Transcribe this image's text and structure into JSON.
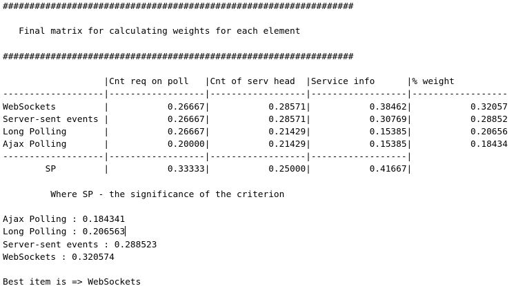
{
  "console": {
    "lines": [
      "##################################################################",
      "",
      "   Final matrix for calculating weights for each element",
      "",
      "##################################################################",
      "",
      "                   |Cnt req on poll   |Cnt of serv head  |Service info      |% weight",
      "-------------------|------------------|------------------|------------------|------------------",
      "WebSockets         |           0.26667|           0.28571|           0.38462|           0.32057",
      "Server-sent events |           0.26667|           0.28571|           0.30769|           0.28852",
      "Long Polling       |           0.26667|           0.21429|           0.15385|           0.20656",
      "Ajax Polling       |           0.20000|           0.21429|           0.15385|           0.18434",
      "-------------------|------------------|------------------|------------------|",
      "        SP         |           0.33333|           0.25000|           0.41667|",
      "",
      "         Where SP - the significance of the criterion",
      "",
      "Ajax Polling : 0.184341",
      "Long Polling : 0.206563",
      "Server-sent events : 0.288523",
      "WebSockets : 0.320574",
      "",
      "Best item is => WebSockets"
    ]
  }
}
